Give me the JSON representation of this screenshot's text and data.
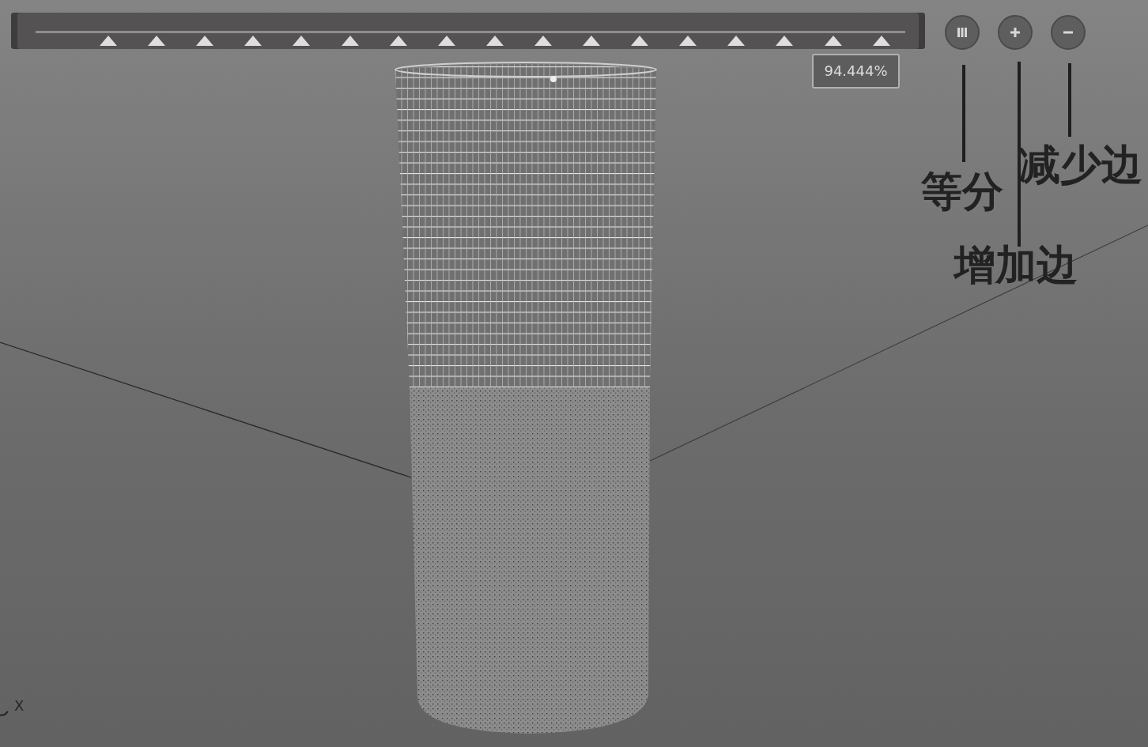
{
  "toolbar": {
    "slider": {
      "reading": "94.444%"
    },
    "buttons": [
      {
        "kind": "divide"
      },
      {
        "kind": "add"
      },
      {
        "kind": "remove"
      }
    ]
  },
  "annotations": [
    {
      "label": "等分"
    },
    {
      "label": "增加边"
    },
    {
      "label": "减少边"
    }
  ],
  "viewport": {
    "axis_label": "X"
  }
}
